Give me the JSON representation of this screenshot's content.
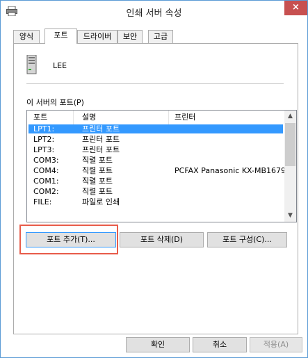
{
  "window": {
    "title": "인쇄 서버 속성",
    "close_label": "×"
  },
  "tabs": [
    {
      "label": "양식",
      "active": false
    },
    {
      "label": "포트",
      "active": true
    },
    {
      "label": "드라이버",
      "active": false
    },
    {
      "label": "보안",
      "active": false
    },
    {
      "label": "고급",
      "active": false
    }
  ],
  "server": {
    "name": "LEE"
  },
  "ports_section": {
    "label": "이 서버의 포트(P)",
    "columns": {
      "port": "포트",
      "description": "설명",
      "printer": "프린터"
    },
    "rows": [
      {
        "port": "LPT1:",
        "description": "프린터 포트",
        "printer": "",
        "selected": true
      },
      {
        "port": "LPT2:",
        "description": "프린터 포트",
        "printer": ""
      },
      {
        "port": "LPT3:",
        "description": "프린터 포트",
        "printer": ""
      },
      {
        "port": "COM3:",
        "description": "직렬 포트",
        "printer": ""
      },
      {
        "port": "COM4:",
        "description": "직렬 포트",
        "printer": "PCFAX Panasonic KX-MB1679..."
      },
      {
        "port": "COM1:",
        "description": "직렬 포트",
        "printer": ""
      },
      {
        "port": "COM2:",
        "description": "직렬 포트",
        "printer": ""
      },
      {
        "port": "FILE:",
        "description": "파일로 인쇄",
        "printer": ""
      }
    ]
  },
  "port_buttons": {
    "add": "포트 추가(T)...",
    "delete": "포트 삭제(D)",
    "configure": "포트 구성(C)..."
  },
  "dialog_buttons": {
    "ok": "확인",
    "cancel": "취소",
    "apply": "적용(A)"
  }
}
